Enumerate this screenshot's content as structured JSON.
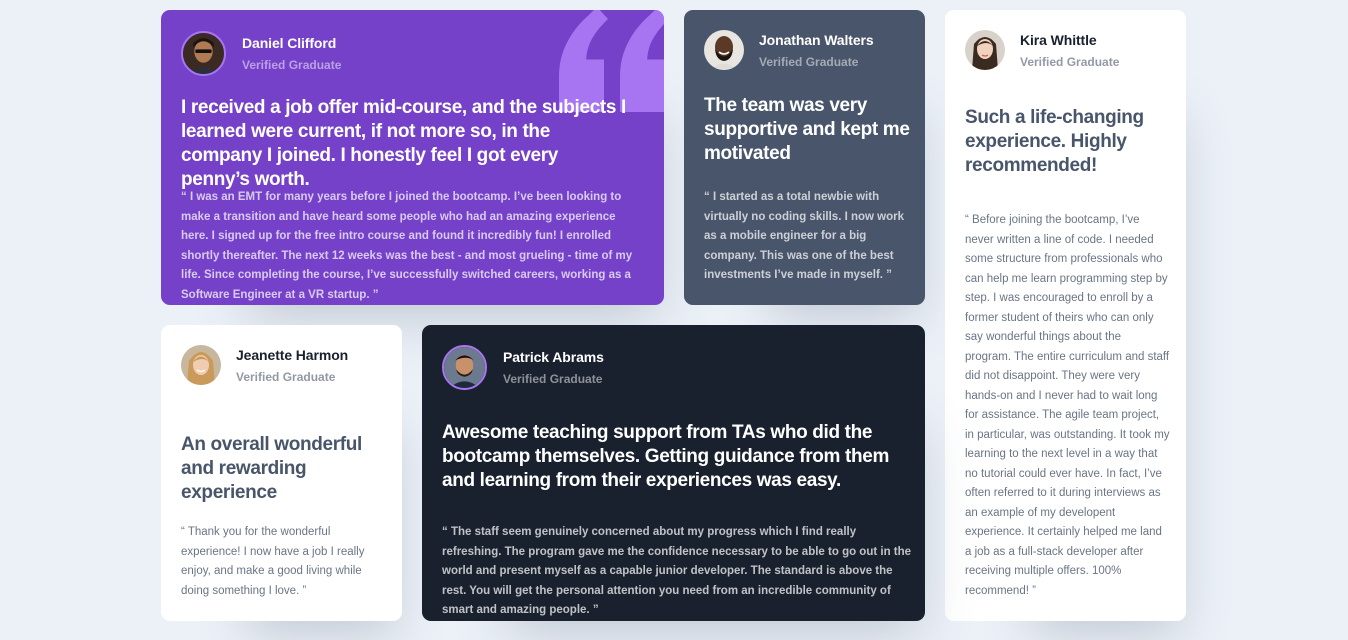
{
  "colors": {
    "background": "#ECF1F8",
    "moderate_violet": "#7541C8",
    "grayish_blue": "#48556A",
    "very_dark_blackish_blue": "#19212E",
    "white": "#FFFFFF",
    "light_violet": "#A775F1"
  },
  "testimonials": [
    {
      "name": "Daniel Clifford",
      "status": "Verified Graduate",
      "avatar_icon": "avatar-daniel-icon",
      "headline": "I received a job offer mid-course, and the subjects I learned were current, if not more so, in the company I joined. I honestly feel I got every penny’s worth.",
      "quote": "“ I was an EMT for many years before I joined the bootcamp. I’ve been looking to make a transition and have heard some people who had an amazing experience here. I signed up for the free intro course and found it incredibly fun! I enrolled shortly thereafter. The next 12 weeks was the best - and most grueling - time of my life. Since completing the course, I’ve successfully switched careers, working as a Software Engineer at a VR startup. ”"
    },
    {
      "name": "Jonathan Walters",
      "status": "Verified Graduate",
      "avatar_icon": "avatar-jonathan-icon",
      "headline": "The team was very supportive and kept me motivated",
      "quote": "“ I started as a total newbie with virtually no coding skills. I now work as a mobile engineer for a big company. This was one of the best investments I’ve made in myself. ”"
    },
    {
      "name": "Kira Whittle",
      "status": "Verified Graduate",
      "avatar_icon": "avatar-kira-icon",
      "headline": "Such a life-changing experience. Highly recommended!",
      "quote": "“ Before joining the bootcamp, I’ve never written a line of code. I needed some structure from professionals who can help me learn programming step by step. I was encouraged to enroll by a former student of theirs who can only say wonderful things about the program. The entire curriculum and staff did not disappoint. They were very hands-on and I never had to wait long for assistance. The agile team project, in particular, was outstanding. It took my learning to the next level in a way that no tutorial could ever have. In fact, I’ve often referred to it during interviews as an example of my developent experience. It certainly helped me land a job as a full-stack developer after receiving multiple offers. 100% recommend! ”"
    },
    {
      "name": "Jeanette Harmon",
      "status": "Verified Graduate",
      "avatar_icon": "avatar-jeanette-icon",
      "headline": "An overall wonderful and rewarding experience",
      "quote": "“ Thank you for the wonderful experience! I now have a job I really enjoy, and make a good living while doing something I love. ”"
    },
    {
      "name": "Patrick Abrams",
      "status": "Verified Graduate",
      "avatar_icon": "avatar-patrick-icon",
      "headline": "Awesome teaching support from TAs who did the bootcamp themselves. Getting guidance from them and learning from their experiences was easy.",
      "quote": "“ The staff seem genuinely concerned about my progress which I find really refreshing. The program gave me the confidence necessary to be able to go out in the world and present myself as a capable junior developer. The standard is above the rest. You will get the personal attention you need from an incredible community of smart and amazing people. ”"
    }
  ],
  "decor": {
    "quote_mark_icon": "quotation-mark-icon"
  }
}
